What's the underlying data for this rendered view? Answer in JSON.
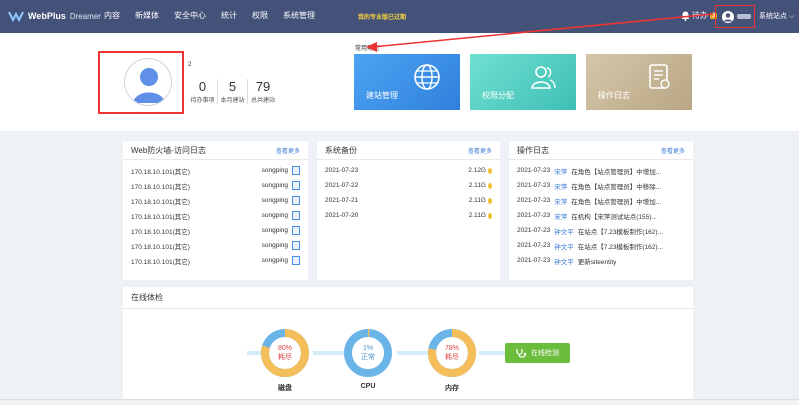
{
  "nav": {
    "brand": "WebPlus",
    "brand_sub": "Dreamer",
    "items": [
      "内容",
      "新媒体",
      "安全中心",
      "统计",
      "权限",
      "系统管理"
    ],
    "slogan": "我的专业版已过期",
    "todo_label": "待办",
    "todo_count": "3",
    "site_selector": "系统站点"
  },
  "profile": {
    "badge": "2",
    "stats": [
      {
        "value": "0",
        "label": "待办事项"
      },
      {
        "value": "5",
        "label": "本月建站"
      },
      {
        "value": "79",
        "label": "总共建站"
      }
    ]
  },
  "quick": {
    "title": "常用功能",
    "tiles": [
      {
        "label": "建站管理",
        "icon": "globe-icon",
        "color": "#3d8fe6"
      },
      {
        "label": "权限分配",
        "icon": "users-icon",
        "color": "#50cfc3"
      },
      {
        "label": "操作日志",
        "icon": "log-document-icon",
        "color": "#c7b796"
      }
    ]
  },
  "firewall": {
    "title": "Web防火墙-访问日志",
    "more": "查看更多",
    "rows": [
      {
        "ip": "170.18.10.101(其它)",
        "user": "songping"
      },
      {
        "ip": "170.18.10.101(其它)",
        "user": "songping"
      },
      {
        "ip": "170.18.10.101(其它)",
        "user": "songping"
      },
      {
        "ip": "170.18.10.101(其它)",
        "user": "songping"
      },
      {
        "ip": "170.18.10.101(其它)",
        "user": "songping"
      },
      {
        "ip": "170.18.10.101(其它)",
        "user": "songping"
      },
      {
        "ip": "170.18.10.101(其它)",
        "user": "songping"
      }
    ]
  },
  "backup": {
    "title": "系统备份",
    "more": "查看更多",
    "rows": [
      {
        "date": "2021-07-23",
        "size": "2.12G"
      },
      {
        "date": "2021-07-22",
        "size": "2.11G"
      },
      {
        "date": "2021-07-21",
        "size": "2.11G"
      },
      {
        "date": "2021-07-20",
        "size": "2.11G"
      }
    ]
  },
  "oplog": {
    "title": "操作日志",
    "more": "查看更多",
    "rows": [
      {
        "date": "2021-07-23",
        "user": "宋萍",
        "text": "在角色【站点管理员】中增加..."
      },
      {
        "date": "2021-07-23",
        "user": "宋萍",
        "text": "在角色【站点管理员】中移除..."
      },
      {
        "date": "2021-07-23",
        "user": "宋萍",
        "text": "在角色【站点管理员】中增加..."
      },
      {
        "date": "2021-07-23",
        "user": "宋萍",
        "text": "在机构【宋萍测试站点(155)..."
      },
      {
        "date": "2021-07-23",
        "user": "钟文平",
        "text": "在站点【7.23模板制作(162)..."
      },
      {
        "date": "2021-07-23",
        "user": "钟文平",
        "text": "在站点【7.23模板制作(162)..."
      },
      {
        "date": "2021-07-23",
        "user": "钟文平",
        "text": "更新siteentity"
      }
    ]
  },
  "health": {
    "title": "在线体检",
    "button": "在线检测",
    "gauges": [
      {
        "name": "磁盘",
        "percent": "80%",
        "status": "耗尽",
        "value": 0.8,
        "color": "#e04040"
      },
      {
        "name": "CPU",
        "percent": "1%",
        "status": "正常",
        "value": 0.01,
        "color": "#4a90c8"
      },
      {
        "name": "内存",
        "percent": "78%",
        "status": "耗尽",
        "value": 0.78,
        "color": "#e04040"
      }
    ]
  }
}
